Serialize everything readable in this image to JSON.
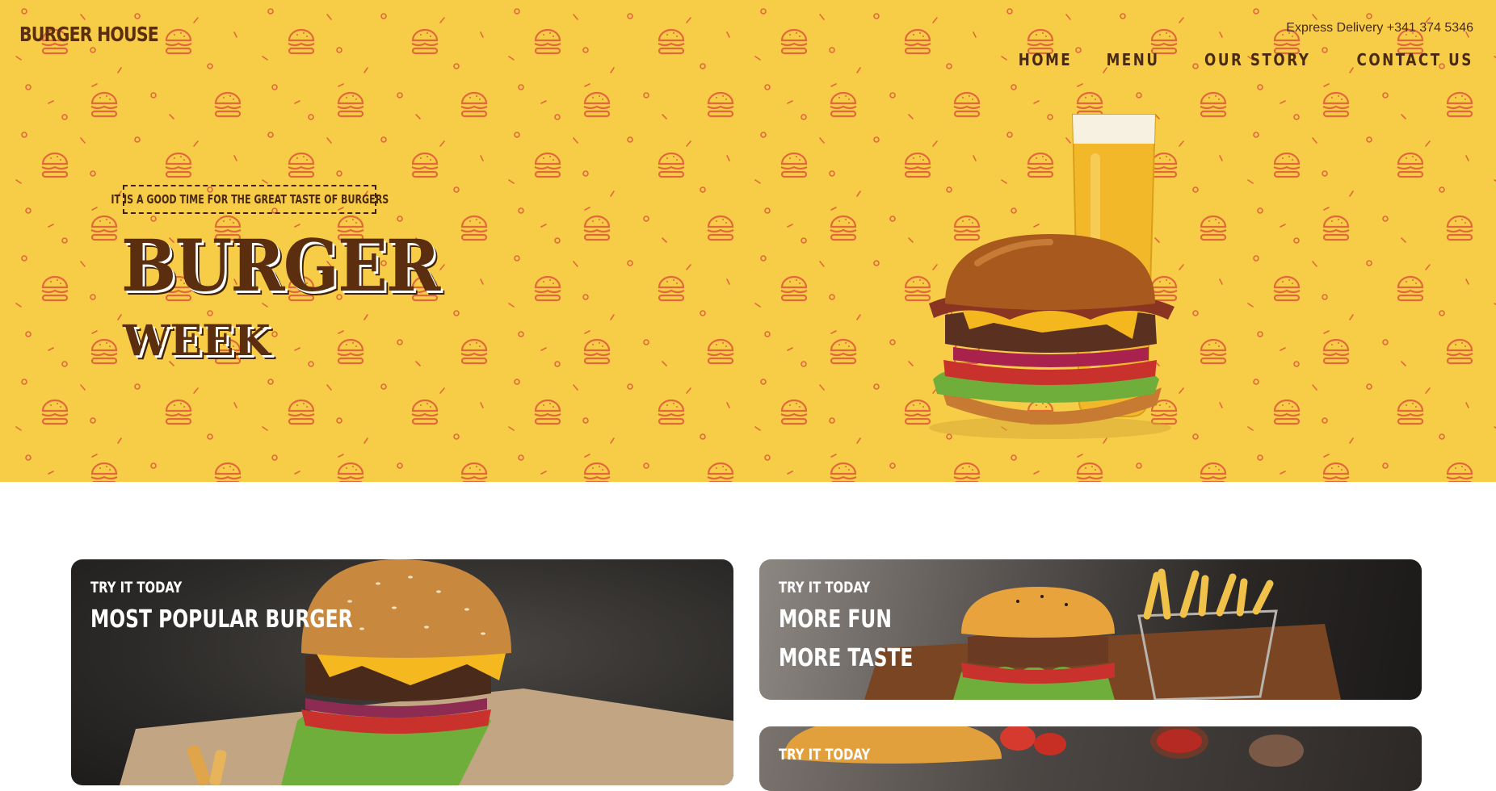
{
  "header": {
    "brand": "BURGER HOUSE",
    "delivery": "Express Delivery +341 374 5346",
    "nav": [
      "HOME",
      "MENU",
      "OUR STORY",
      "CONTACT US"
    ]
  },
  "hero": {
    "tagline": "IT IS A GOOD TIME FOR THE GREAT TASTE OF BURGERS",
    "title": "BURGER",
    "subtitle": "WEEK"
  },
  "cards": [
    {
      "eyebrow": "TRY IT TODAY",
      "title_lines": [
        "MOST POPULAR BURGER"
      ]
    },
    {
      "eyebrow": "TRY IT TODAY",
      "title_lines": [
        "MORE FUN",
        "MORE TASTE"
      ]
    },
    {
      "eyebrow": "TRY IT TODAY",
      "title_lines": []
    }
  ],
  "colors": {
    "hero_background": "#f7cd48",
    "pattern": "#e2673b",
    "brand_brown": "#5a2e0e",
    "card_text": "#ffffff"
  }
}
